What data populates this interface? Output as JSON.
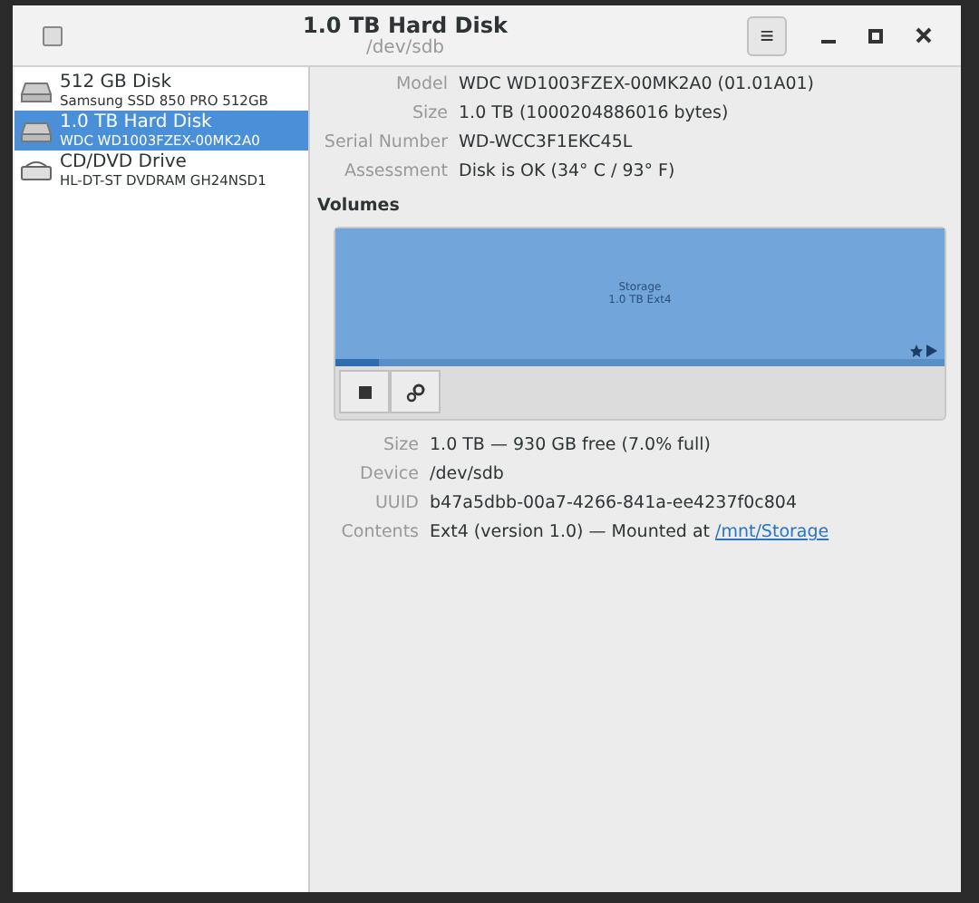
{
  "window": {
    "title": "1.0 TB Hard Disk",
    "subtitle": "/dev/sdb",
    "menu_button": "≡"
  },
  "sidebar": {
    "items": [
      {
        "kind": "disk",
        "name": "512 GB Disk",
        "detail": "Samsung SSD 850 PRO 512GB",
        "selected": false
      },
      {
        "kind": "disk",
        "name": "1.0 TB Hard Disk",
        "detail": "WDC WD1003FZEX-00MK2A0",
        "selected": true
      },
      {
        "kind": "optical",
        "name": "CD/DVD Drive",
        "detail": "HL-DT-ST DVDRAM GH24NSD1",
        "selected": false
      }
    ]
  },
  "drive": [
    {
      "label": "Model",
      "value": "WDC WD1003FZEX-00MK2A0 (01.01A01)"
    },
    {
      "label": "Size",
      "value": "1.0 TB (1000204886016 bytes)"
    },
    {
      "label": "Serial Number",
      "value": "WD-WCC3F1EKC45L"
    },
    {
      "label": "Assessment",
      "value": "Disk is OK (34° C / 93° F)"
    }
  ],
  "volumes": {
    "heading": "Volumes",
    "partition": {
      "name": "Storage",
      "detail": "1.0 TB Ext4",
      "level": 0.07
    },
    "properties": [
      {
        "label": "Size",
        "value": "1.0 TB — 930 GB free (7.0% full)"
      },
      {
        "label": "Device",
        "value": "/dev/sdb"
      },
      {
        "label": "UUID",
        "value": "b47a5dbb-00a7-4266-841a-ee4237f0c804"
      },
      {
        "label": "Contents",
        "value": "Ext4 (version 1.0) — Mounted at ",
        "link": "/mnt/Storage"
      }
    ]
  }
}
